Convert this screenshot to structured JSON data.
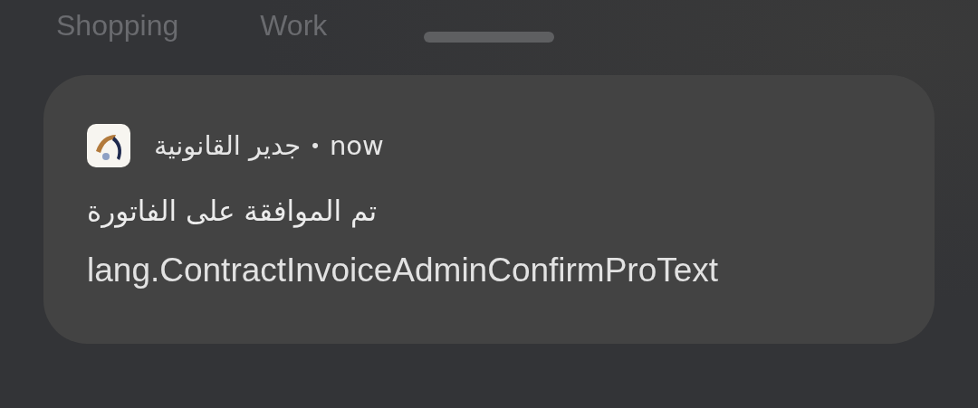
{
  "background_tabs": {
    "left_label": "Shopping",
    "right_label": "Work"
  },
  "notification": {
    "app_name": "جدير القانونية",
    "separator": "•",
    "time": "now",
    "title": "تم الموافقة على الفاتورة",
    "body": "lang.ContractInvoiceAdminConfirmProText"
  }
}
